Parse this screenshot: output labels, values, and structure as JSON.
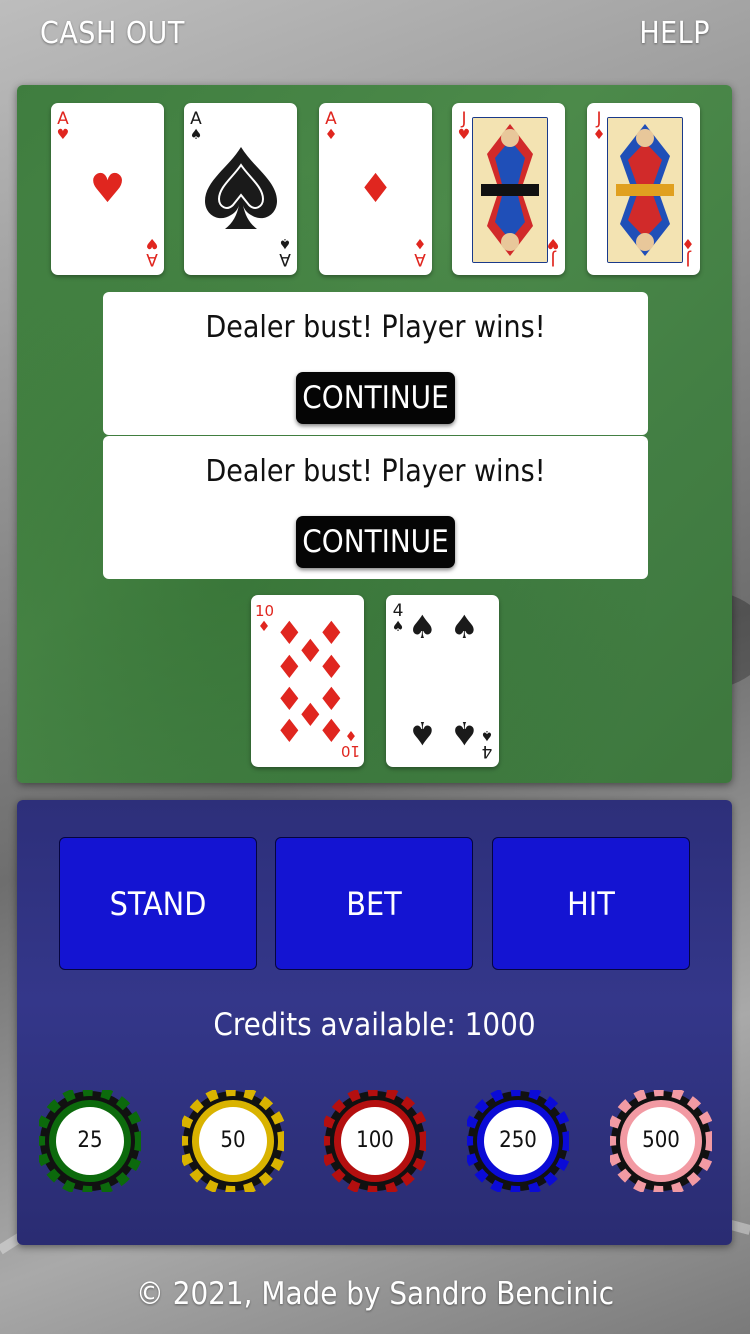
{
  "header": {
    "cash_out_label": "CASH OUT",
    "help_label": "HELP"
  },
  "dealer_hand": [
    {
      "rank": "A",
      "suit": "♥",
      "color": "#e0261f"
    },
    {
      "rank": "A",
      "suit": "♠",
      "color": "#1a1a1a"
    },
    {
      "rank": "A",
      "suit": "♦",
      "color": "#e0261f"
    },
    {
      "rank": "J",
      "suit": "♥",
      "color": "#e0261f"
    },
    {
      "rank": "J",
      "suit": "♦",
      "color": "#e0261f"
    }
  ],
  "messages": [
    {
      "text": "Dealer bust! Player wins!",
      "button": "CONTINUE"
    },
    {
      "text": "Dealer bust! Player wins!",
      "button": "CONTINUE"
    }
  ],
  "player_hand": [
    {
      "rank": "10",
      "suit": "♦",
      "color": "#e0261f"
    },
    {
      "rank": "4",
      "suit": "♠",
      "color": "#1a1a1a"
    }
  ],
  "actions": {
    "stand": "STAND",
    "bet": "BET",
    "hit": "HIT"
  },
  "credits_text": "Credits available: 1000",
  "chips": [
    {
      "value": "25",
      "color": "#0c6a0c"
    },
    {
      "value": "50",
      "color": "#d9b300"
    },
    {
      "value": "100",
      "color": "#b40f0f"
    },
    {
      "value": "250",
      "color": "#0b0bd6"
    },
    {
      "value": "500",
      "color": "#f29aa3"
    }
  ],
  "footer": "© 2021, Made by Sandro Bencinic"
}
